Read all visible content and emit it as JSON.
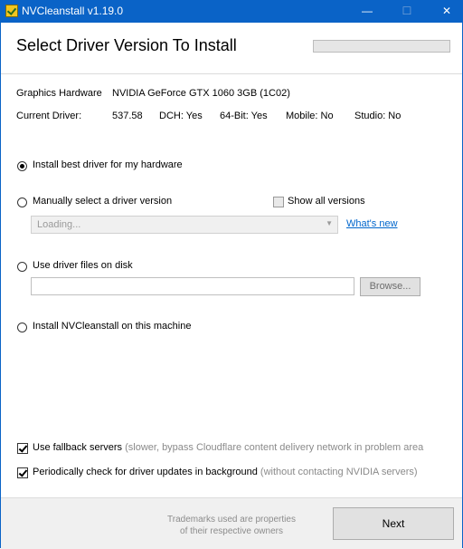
{
  "window": {
    "title": "NVCleanstall v1.19.0",
    "min_glyph": "—",
    "max_glyph": "☐",
    "close_glyph": "✕"
  },
  "header": {
    "title": "Select Driver Version To Install",
    "progress_percent": 0
  },
  "hardware": {
    "label": "Graphics Hardware",
    "value": "NVIDIA GeForce GTX 1060 3GB (1C02)"
  },
  "current_driver": {
    "label": "Current Driver:",
    "version": "537.58",
    "dch": "DCH: Yes",
    "bit64": "64-Bit: Yes",
    "mobile": "Mobile: No",
    "studio": "Studio: No"
  },
  "options": {
    "best_driver": {
      "label": "Install best driver for my hardware",
      "selected": true
    },
    "manual": {
      "label": "Manually select a driver version",
      "selected": false
    },
    "show_all_label": "Show all versions",
    "version_combo": "Loading...",
    "whats_new": "What's new",
    "disk": {
      "label": "Use driver files on disk",
      "selected": false
    },
    "browse_label": "Browse...",
    "disk_path": "",
    "install_self": {
      "label": "Install NVCleanstall on this machine",
      "selected": false
    }
  },
  "settings": {
    "fallback_label": "Use fallback servers",
    "fallback_note": "(slower, bypass Cloudflare content delivery network in problem area",
    "periodic_label": "Periodically check for driver updates in background",
    "periodic_note": "(without contacting NVIDIA servers)"
  },
  "footer": {
    "trademark_line1": "Trademarks used are properties",
    "trademark_line2": "of their respective owners",
    "next_label": "Next"
  }
}
